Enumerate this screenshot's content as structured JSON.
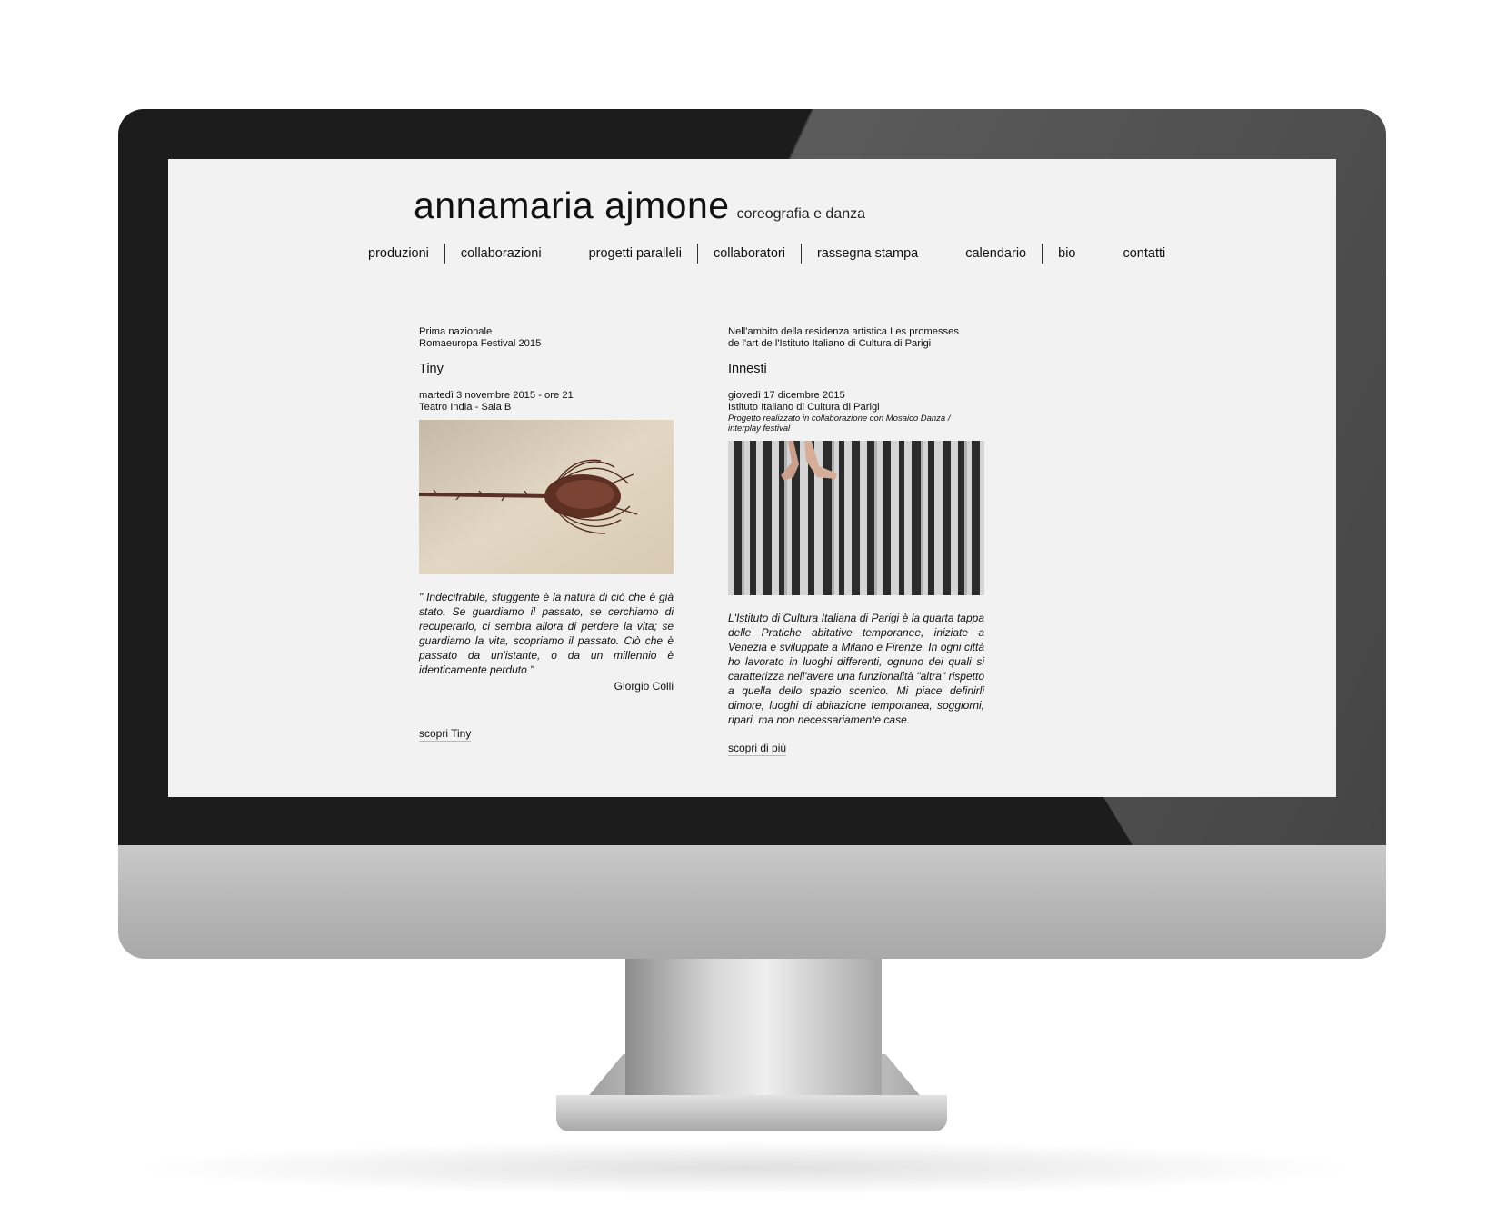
{
  "site": {
    "title": "annamaria ajmone",
    "subtitle": "coreografia e danza"
  },
  "nav": [
    "produzioni",
    "collaborazioni",
    "progetti paralleli",
    "collaboratori",
    "rassegna stampa",
    "calendario",
    "bio",
    "contatti"
  ],
  "left_event": {
    "kicker_1": "Prima nazionale",
    "kicker_2": "Romaeuropa Festival 2015",
    "title": "Tiny",
    "date": "martedì 3 novembre 2015 - ore 21",
    "venue": "Teatro India - Sala B",
    "quote": "\" Indecifrabile, sfuggente è la natura di ciò che è già stato. Se guardiamo il passato, se cerchiamo di recuperarlo, ci sembra allora di perdere la vita; se guardiamo la vita, scopriamo il passato. Ciò che è passato da un'istante, o da un millennio è identicamente perduto \"",
    "quote_author": "Giorgio Colli",
    "link": "scopri Tiny"
  },
  "right_event": {
    "kicker_1": "Nell'ambito della residenza artistica Les promesses",
    "kicker_2": "de l'art de l'Istituto Italiano di Cultura di Parigi",
    "title": "Innesti",
    "date": "giovedì 17 dicembre 2015",
    "venue": "Istituto Italiano di Cultura di Parigi",
    "note": "Progetto realizzato in collaborazione con Mosaico Danza / interplay festival",
    "body": "L'Istituto di Cultura Italiana di Parigi è la quarta tappa delle Pratiche abitative temporanee, iniziate a Venezia e sviluppate a Milano e Firenze. In ogni città ho lavorato in luoghi differenti, ognuno dei quali si caratterizza nell'avere una funzionalità \"altra\" rispetto a quella dello spazio scenico. Mi piace definirli dimore, luoghi di abitazione temporanea, soggiorni, ripari, ma non necessariamente case.",
    "link": "scopri di più"
  }
}
